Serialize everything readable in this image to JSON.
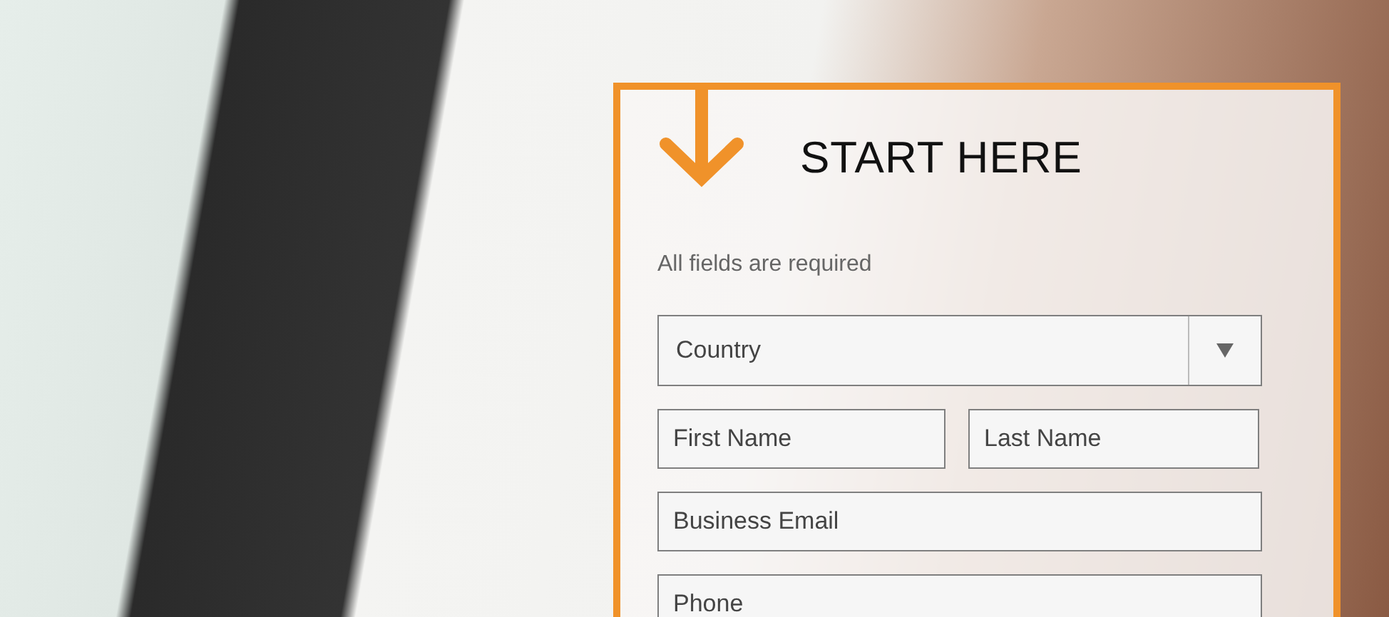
{
  "form": {
    "title": "START HERE",
    "note": "All fields are required",
    "fields": [
      {
        "kind": "select",
        "placeholder": "Country"
      },
      {
        "kind": "pair",
        "items": [
          {
            "placeholder": "First Name"
          },
          {
            "placeholder": "Last Name"
          }
        ]
      },
      {
        "kind": "text",
        "placeholder": "Business Email"
      },
      {
        "kind": "text",
        "placeholder": "Phone"
      }
    ]
  }
}
